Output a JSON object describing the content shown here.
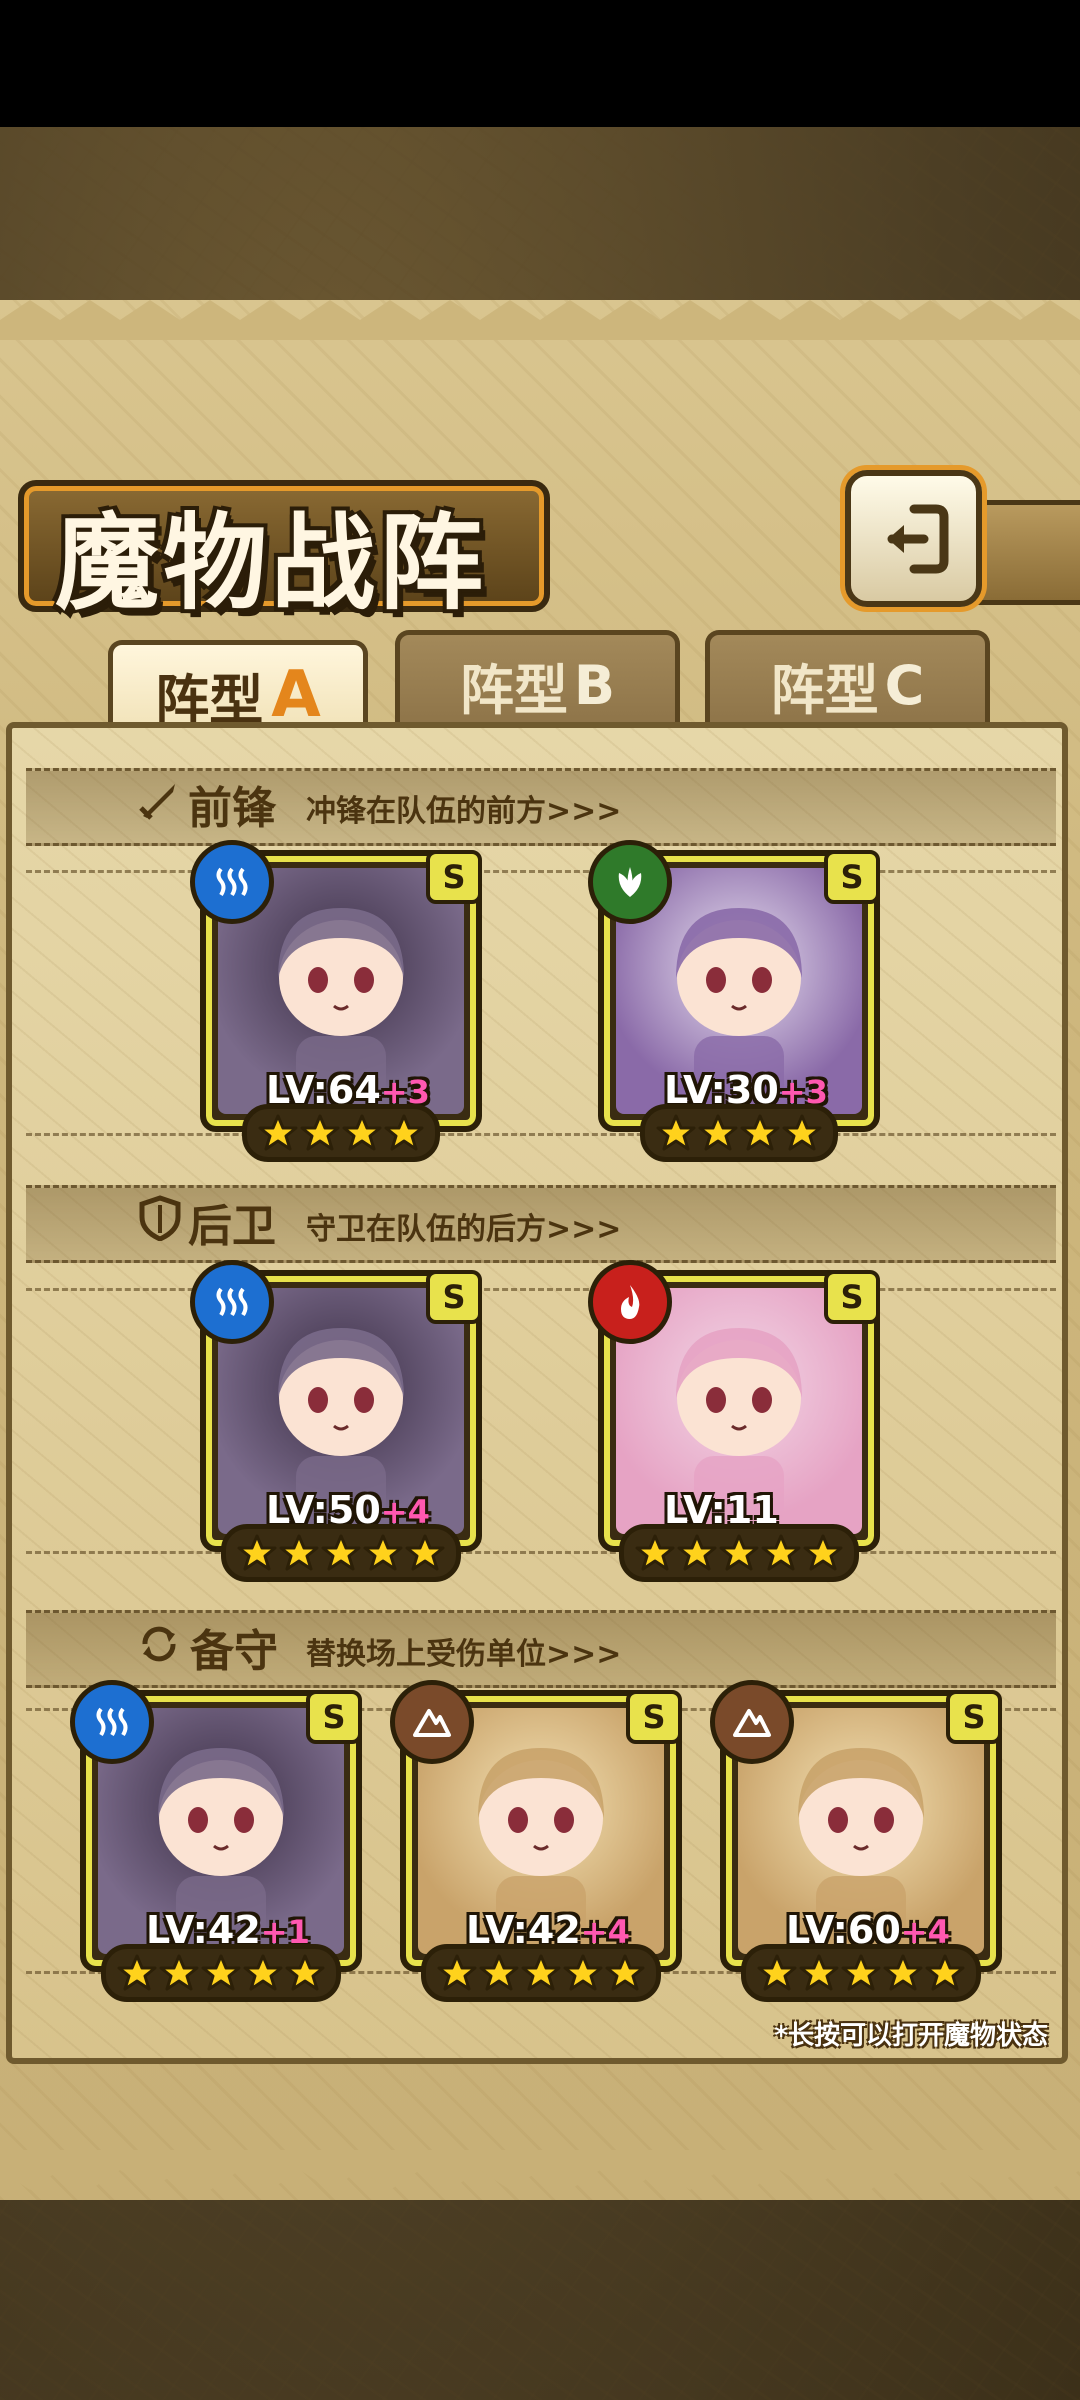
{
  "title": "魔物战阵",
  "tabs": [
    {
      "label": "阵型",
      "letter": "A",
      "active": true
    },
    {
      "label": "阵型",
      "letter": "B",
      "active": false
    },
    {
      "label": "阵型",
      "letter": "C",
      "active": false
    }
  ],
  "sections": {
    "vanguard": {
      "title": "前锋",
      "desc": "冲锋在队伍的前方>>>",
      "icon": "sword-icon"
    },
    "rearguard": {
      "title": "后卫",
      "desc": "守卫在队伍的后方>>>",
      "icon": "shield-icon"
    },
    "reserve": {
      "title": "备守",
      "desc": "替换场上受伤单位>>>",
      "icon": "swap-icon"
    }
  },
  "vanguard_units": [
    {
      "rank": "S",
      "element": "water-icon",
      "level": "LV:64",
      "plus": "+3",
      "stars": 4
    },
    {
      "rank": "S",
      "element": "leaf-icon",
      "level": "LV:30",
      "plus": "+3",
      "stars": 4
    }
  ],
  "rearguard_units": [
    {
      "rank": "S",
      "element": "water-icon",
      "level": "LV:50",
      "plus": "+4",
      "stars": 5
    },
    {
      "rank": "S",
      "element": "fire-icon",
      "level": "LV:11",
      "plus": "",
      "stars": 5
    }
  ],
  "reserve_units": [
    {
      "rank": "S",
      "element": "water-icon",
      "level": "LV:42",
      "plus": "+1",
      "stars": 5
    },
    {
      "rank": "S",
      "element": "earth-icon",
      "level": "LV:42",
      "plus": "+4",
      "stars": 5
    },
    {
      "rank": "S",
      "element": "earth-icon",
      "level": "LV:60",
      "plus": "+4",
      "stars": 5
    }
  ],
  "footnote": "*长按可以打开魔物状态",
  "colors": {
    "water": "#1d6fd1",
    "leaf": "#2f7a2a",
    "fire": "#c8201c",
    "earth": "#7a4a2a",
    "card_frame": "#e8e24c",
    "accent_orange": "#e4861c"
  }
}
